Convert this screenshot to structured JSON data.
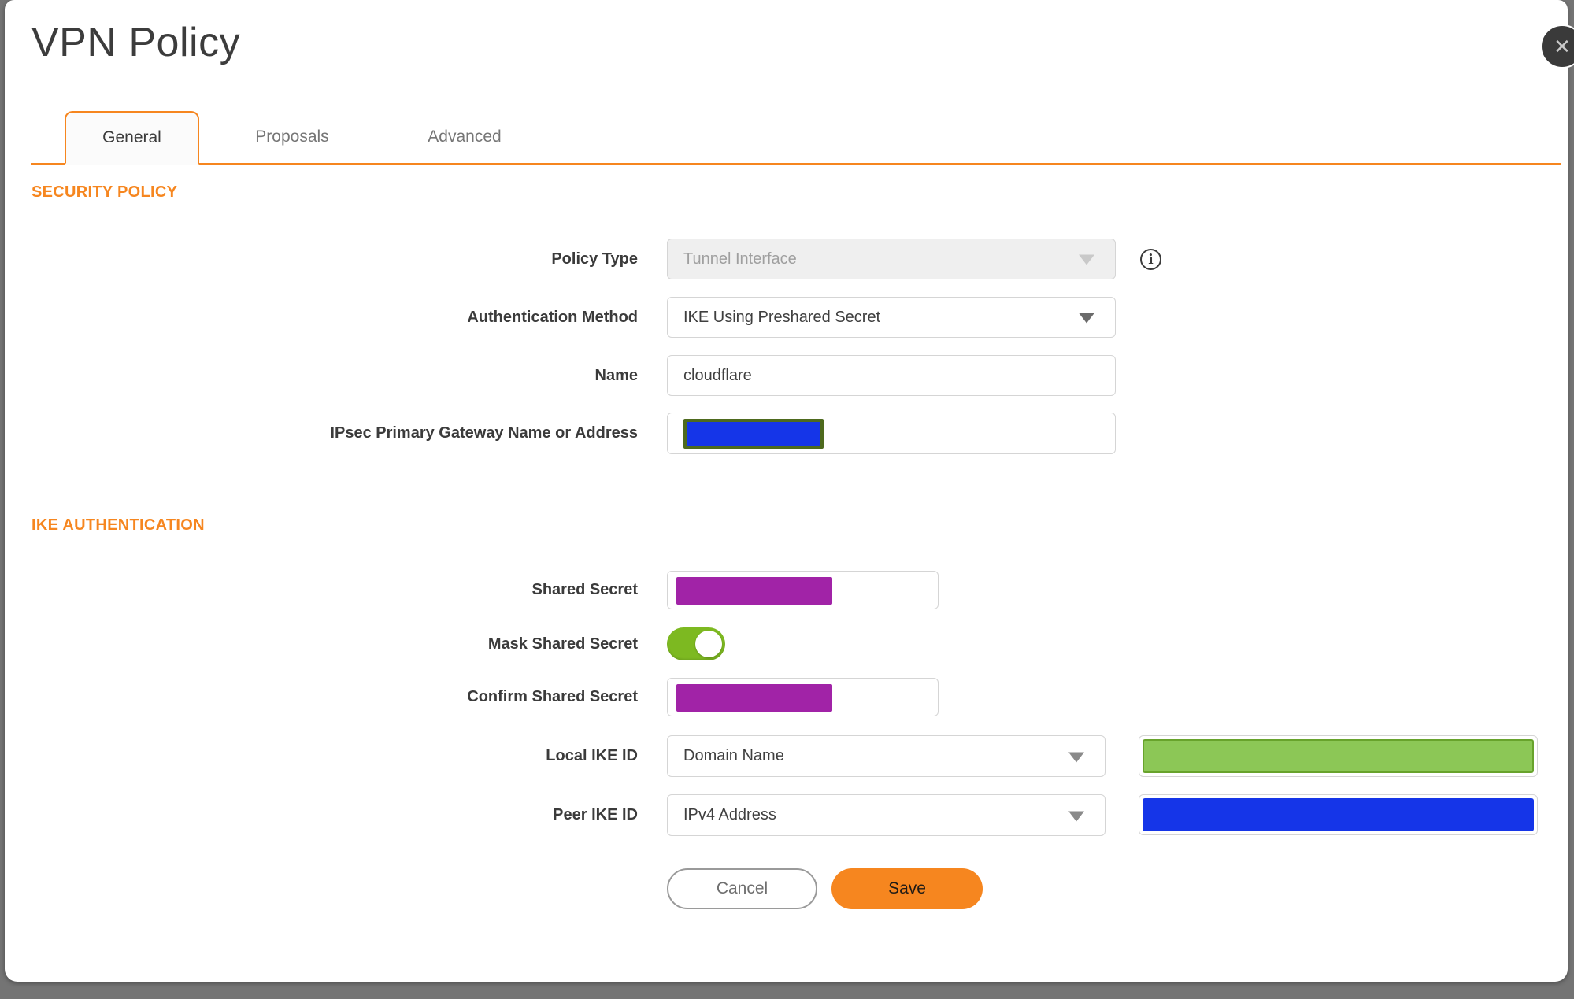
{
  "dialog": {
    "title": "VPN Policy"
  },
  "icons": {
    "close_glyph": "✕",
    "info_glyph": "i"
  },
  "tabs": [
    {
      "label": "General",
      "active": true
    },
    {
      "label": "Proposals",
      "active": false
    },
    {
      "label": "Advanced",
      "active": false
    }
  ],
  "security_policy": {
    "heading": "SECURITY POLICY",
    "policy_type": {
      "label": "Policy Type",
      "value": "Tunnel Interface",
      "disabled": true
    },
    "authentication_method": {
      "label": "Authentication Method",
      "value": "IKE Using Preshared Secret"
    },
    "name": {
      "label": "Name",
      "value": "cloudflare"
    },
    "gateway": {
      "label": "IPsec Primary Gateway Name or Address",
      "value_masked": true
    }
  },
  "ike_authentication": {
    "heading": "IKE AUTHENTICATION",
    "shared_secret": {
      "label": "Shared Secret",
      "value_masked": true
    },
    "mask_shared_secret": {
      "label": "Mask Shared Secret",
      "enabled": true
    },
    "confirm_shared_secret": {
      "label": "Confirm Shared Secret",
      "value_masked": true
    },
    "local_ike_id": {
      "label": "Local IKE ID",
      "value": "Domain Name",
      "id_value_masked": true
    },
    "peer_ike_id": {
      "label": "Peer IKE ID",
      "value": "IPv4 Address",
      "id_value_masked": true
    }
  },
  "actions": {
    "cancel": "Cancel",
    "save": "Save"
  },
  "colors": {
    "accent_orange": "#F6861F",
    "mask_purple": "#A123A7",
    "mask_blue": "#1535E8",
    "mask_green_fill": "#8CC756",
    "mask_green_border": "#68A32C",
    "mask_olive_border": "#4E6A1E",
    "toggle_green": "#7DB921"
  }
}
